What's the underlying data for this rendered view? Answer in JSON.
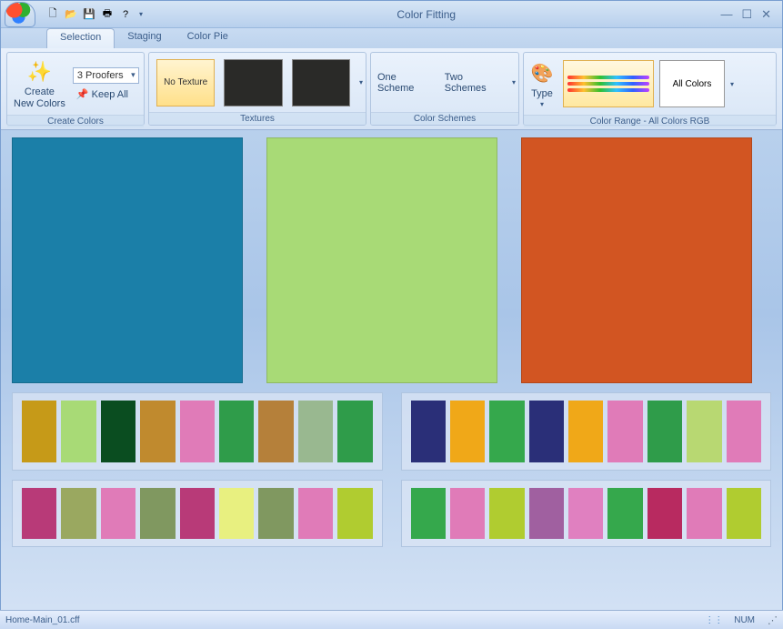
{
  "app": {
    "title": "Color Fitting"
  },
  "qat": [
    {
      "name": "new-icon",
      "glyph": "🗋"
    },
    {
      "name": "open-icon",
      "glyph": "📂"
    },
    {
      "name": "save-icon",
      "glyph": "💾"
    },
    {
      "name": "print-icon",
      "glyph": "🖶"
    },
    {
      "name": "help-icon",
      "glyph": "?"
    }
  ],
  "tabs": [
    {
      "label": "Selection",
      "active": true
    },
    {
      "label": "Staging",
      "active": false
    },
    {
      "label": "Color Pie",
      "active": false
    }
  ],
  "ribbon": {
    "create_colors": {
      "label": "Create Colors",
      "create_btn": "Create\nNew Colors",
      "proofers": "3 Proofers",
      "keep_all": "Keep All"
    },
    "textures": {
      "label": "Textures",
      "no_texture": "No Texture"
    },
    "schemes": {
      "label": "Color Schemes",
      "one": "One Scheme",
      "two": "Two Schemes"
    },
    "range": {
      "label": "Color Range - All Colors RGB",
      "type": "Type",
      "all_colors": "All Colors"
    }
  },
  "big_swatches": [
    "#1b7fa8",
    "#a8da76",
    "#d25522"
  ],
  "palettes": {
    "top_left": [
      "#c69a18",
      "#a8da76",
      "#0a4d20",
      "#c08a2e",
      "#e07bb8",
      "#2f9c4a",
      "#b5803a",
      "#99b890",
      "#2f9c4a"
    ],
    "top_right": [
      "#2a2f78",
      "#f0a818",
      "#35a84c",
      "#2a2f78",
      "#f0a818",
      "#e07bb8",
      "#2f9c4a",
      "#b8d872",
      "#e07bb8"
    ],
    "bot_left": [
      "#b83a78",
      "#9aa860",
      "#e07bb8",
      "#809860",
      "#b83a78",
      "#e8f080",
      "#809860",
      "#e07bb8",
      "#b0cc30"
    ],
    "bot_right": [
      "#35a84c",
      "#e07bb8",
      "#b0cc30",
      "#a060a0",
      "#e080c0",
      "#35a84c",
      "#b82a60",
      "#e07bb8",
      "#b0cc30"
    ]
  },
  "status": {
    "file": "Home-Main_01.cff",
    "num": "NUM"
  }
}
